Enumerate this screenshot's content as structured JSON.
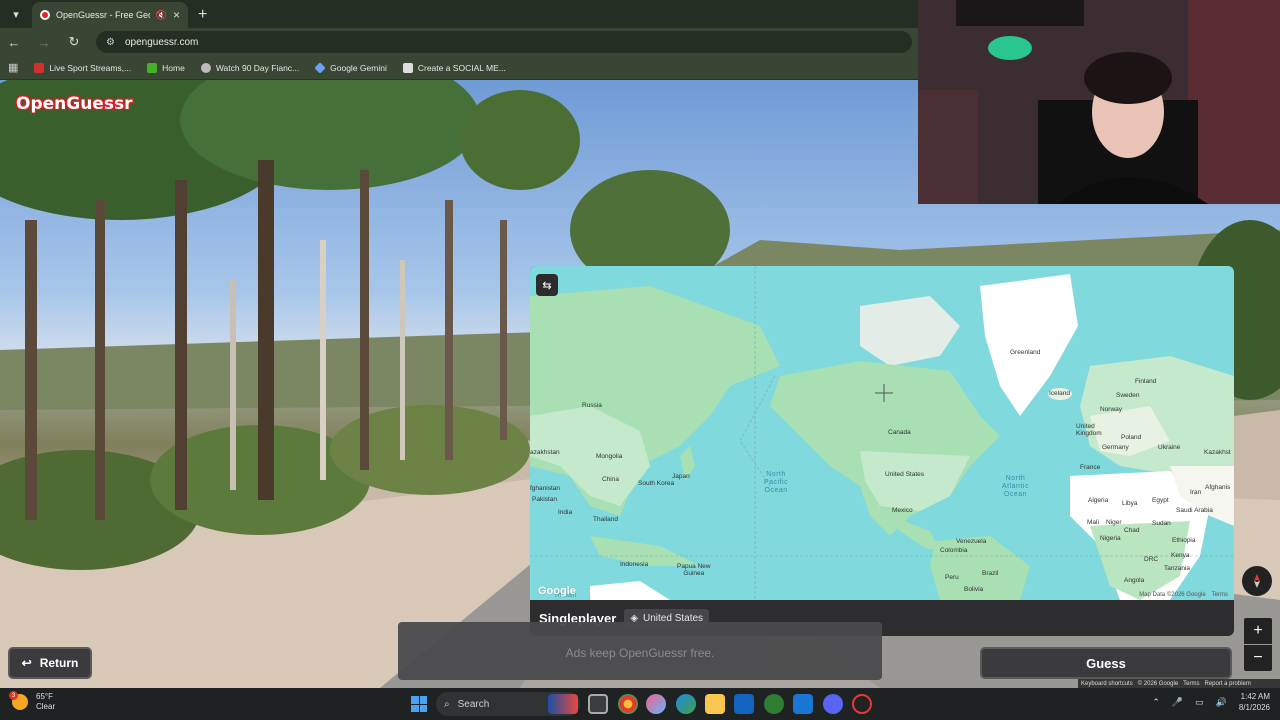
{
  "browser": {
    "tab_title": "OpenGuessr - Free GeoGue",
    "url": "openguessr.com",
    "bookmarks": [
      {
        "label": "Live Sport Streams,...",
        "color": "#d32f2f"
      },
      {
        "label": "Home",
        "color": "#43b02a"
      },
      {
        "label": "Watch 90 Day Fianc...",
        "color": "#bbbbbb"
      },
      {
        "label": "Google Gemini",
        "color": "#6aa0f8"
      },
      {
        "label": "Create a SOCIAL ME...",
        "color": "#dddddd"
      }
    ]
  },
  "game": {
    "logo": "OpenGuessr",
    "mode": "Singleplayer",
    "region": "United States",
    "ads_text": "Ads keep OpenGuessr free.",
    "return_label": "Return",
    "guess_label": "Guess",
    "zoom_in": "+",
    "zoom_out": "−"
  },
  "map": {
    "labels": {
      "greenland": "Greenland",
      "iceland": "Iceland",
      "finland": "Finland",
      "sweden": "Sweden",
      "norway": "Norway",
      "united_kingdom": "United\nKingdom",
      "poland": "Poland",
      "germany": "Germany",
      "ukraine": "Ukraine",
      "france": "France",
      "kazakhstan_e": "Kazakhst",
      "iran": "Iran",
      "afghanistan_e": "Afghanis",
      "russia": "Russia",
      "kazakhstan_w": "azakhstan",
      "mongolia": "Mongolia",
      "china": "China",
      "south_korea": "South Korea",
      "japan": "Japan",
      "afghanistan_w": "fghanistan",
      "pakistan": "Pakistan",
      "india": "India",
      "thailand": "Thailand",
      "indonesia": "Indonesia",
      "papua": "Papua New\nGuinea",
      "canada": "Canada",
      "united_states": "United States",
      "mexico": "Mexico",
      "venezuela": "Venezuela",
      "colombia": "Colombia",
      "brazil": "Brazil",
      "peru": "Peru",
      "bolivia": "Bolivia",
      "algeria": "Algeria",
      "libya": "Libya",
      "egypt": "Egypt",
      "saudi": "Saudi Arabia",
      "mali": "Mali",
      "niger": "Niger",
      "chad": "Chad",
      "sudan": "Sudan",
      "nigeria": "Nigeria",
      "ethiopia": "Ethiopia",
      "drc": "DRC",
      "kenya": "Kenya",
      "tanzania": "Tanzania",
      "angola": "Angola",
      "north_pacific": "North\nPacific\nOcean",
      "north_atlantic": "North\nAtlantic\nOcean",
      "indian_lbl": "Indian"
    },
    "google_mark": "Google",
    "attribution": "Map Data ©2026 Google",
    "terms": "Terms"
  },
  "streetview_footer": {
    "shortcuts": "Keyboard shortcuts",
    "copyright": "© 2026 Google",
    "terms": "Terms",
    "report": "Report a problem"
  },
  "taskbar": {
    "weather_temp": "65°F",
    "weather_desc": "Clear",
    "weather_badge": "3",
    "search_label": "Search",
    "time": "1:42 AM",
    "date": "8/1/2026"
  }
}
